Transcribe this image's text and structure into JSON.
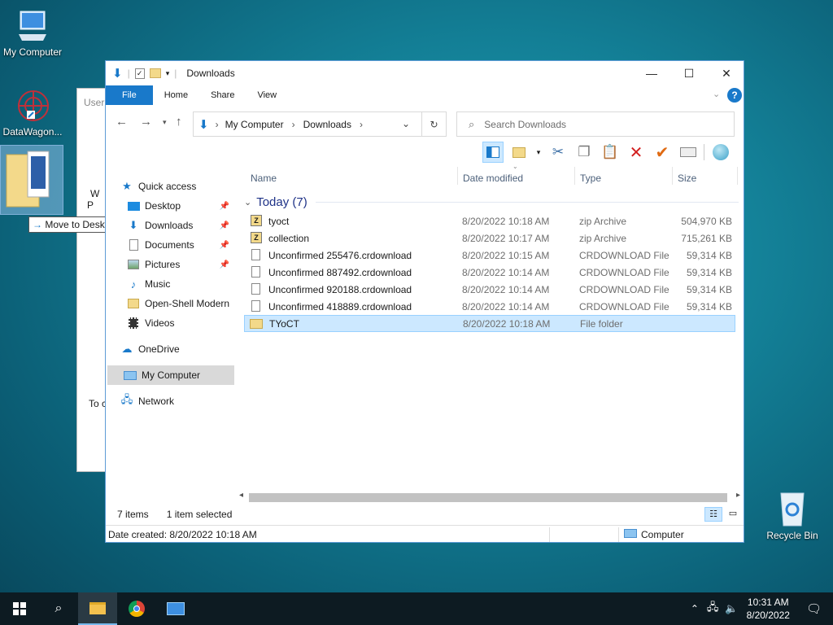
{
  "desktop": {
    "icons": [
      {
        "label": "My Computer"
      },
      {
        "label": "DataWagon..."
      },
      {
        "label": "Recycle Bin"
      }
    ],
    "drag_tooltip": "Move to Desktop"
  },
  "background_window": {
    "title": "User",
    "letters": [
      "W",
      "P"
    ],
    "footer_text": "To c"
  },
  "window": {
    "title": "Downloads",
    "ribbon_tabs": [
      "File",
      "Home",
      "Share",
      "View"
    ],
    "address": {
      "crumbs": [
        "My Computer",
        "Downloads"
      ]
    },
    "search": {
      "placeholder": "Search Downloads"
    },
    "nav": {
      "quick_access": "Quick access",
      "pinned": [
        "Desktop",
        "Downloads",
        "Documents",
        "Pictures"
      ],
      "others": [
        "Music",
        "Open-Shell Modern",
        "Videos"
      ],
      "onedrive": "OneDrive",
      "my_computer": "My Computer",
      "network": "Network"
    },
    "columns": {
      "name": "Name",
      "date": "Date modified",
      "type": "Type",
      "size": "Size"
    },
    "group": "Today (7)",
    "files": [
      {
        "name": "tyoct",
        "date": "8/20/2022 10:18 AM",
        "type": "zip Archive",
        "size": "504,970 KB",
        "icon": "zip-icon"
      },
      {
        "name": "collection",
        "date": "8/20/2022 10:17 AM",
        "type": "zip Archive",
        "size": "715,261 KB",
        "icon": "zip-icon"
      },
      {
        "name": "Unconfirmed 255476.crdownload",
        "date": "8/20/2022 10:15 AM",
        "type": "CRDOWNLOAD File",
        "size": "59,314 KB",
        "icon": "file-icon"
      },
      {
        "name": "Unconfirmed 887492.crdownload",
        "date": "8/20/2022 10:14 AM",
        "type": "CRDOWNLOAD File",
        "size": "59,314 KB",
        "icon": "file-icon"
      },
      {
        "name": "Unconfirmed 920188.crdownload",
        "date": "8/20/2022 10:14 AM",
        "type": "CRDOWNLOAD File",
        "size": "59,314 KB",
        "icon": "file-icon"
      },
      {
        "name": "Unconfirmed 418889.crdownload",
        "date": "8/20/2022 10:14 AM",
        "type": "CRDOWNLOAD File",
        "size": "59,314 KB",
        "icon": "file-icon"
      },
      {
        "name": "TYoCT",
        "date": "8/20/2022 10:18 AM",
        "type": "File folder",
        "size": "",
        "icon": "folder-icon"
      }
    ],
    "status": {
      "items": "7 items",
      "selected": "1 item selected"
    },
    "details": {
      "created": "Date created: 8/20/2022 10:18 AM",
      "location": "Computer"
    }
  },
  "taskbar": {
    "time": "10:31 AM",
    "date": "8/20/2022"
  },
  "colors": {
    "accent": "#1979ca",
    "selection": "#cce8ff"
  }
}
